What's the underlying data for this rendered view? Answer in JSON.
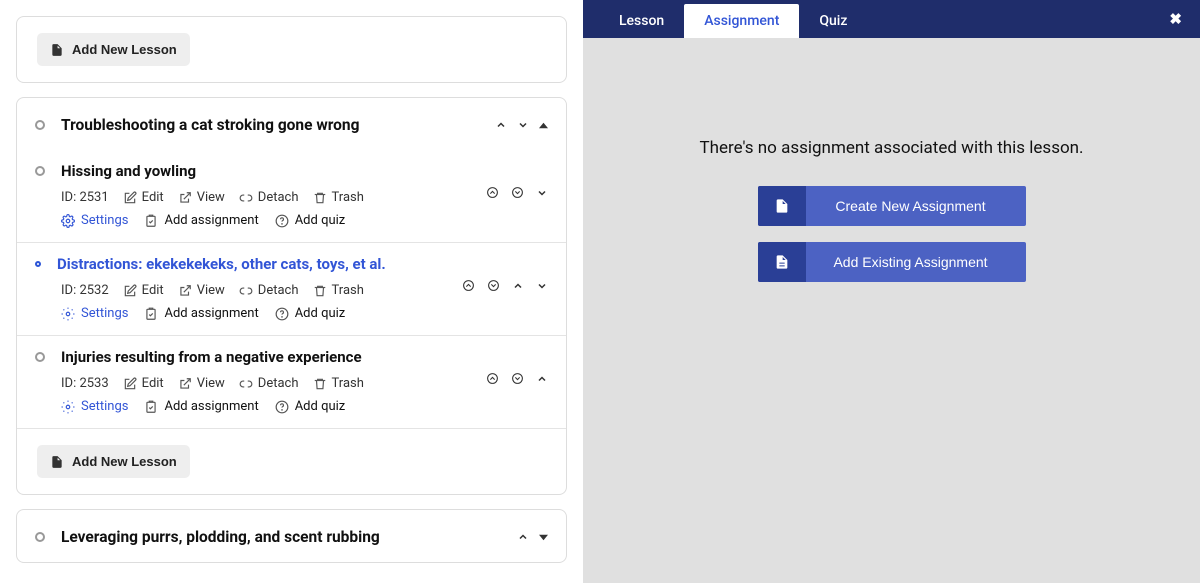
{
  "left": {
    "add_lesson_label": "Add New Lesson",
    "section1": {
      "title": "Troubleshooting a cat stroking gone wrong"
    },
    "lessons": [
      {
        "title": "Hissing and yowling",
        "active": false,
        "id_label": "ID: 2531",
        "edit": "Edit",
        "view": "View",
        "detach": "Detach",
        "trash": "Trash",
        "settings": "Settings",
        "add_assignment": "Add assignment",
        "add_quiz": "Add quiz",
        "chev_up": false,
        "chev_down": true
      },
      {
        "title": "Distractions: ekekekekeks, other cats, toys, et al.",
        "active": true,
        "id_label": "ID: 2532",
        "edit": "Edit",
        "view": "View",
        "detach": "Detach",
        "trash": "Trash",
        "settings": "Settings",
        "add_assignment": "Add assignment",
        "add_quiz": "Add quiz",
        "chev_up": true,
        "chev_down": true
      },
      {
        "title": "Injuries resulting from a negative experience",
        "active": false,
        "id_label": "ID: 2533",
        "edit": "Edit",
        "view": "View",
        "detach": "Detach",
        "trash": "Trash",
        "settings": "Settings",
        "add_assignment": "Add assignment",
        "add_quiz": "Add quiz",
        "chev_up": true,
        "chev_down": false
      }
    ],
    "section2": {
      "title": "Leveraging purrs, plodding, and scent rubbing"
    }
  },
  "right": {
    "tabs": {
      "lesson": "Lesson",
      "assignment": "Assignment",
      "quiz": "Quiz"
    },
    "empty_state": "There's no assignment associated with this lesson.",
    "create_btn": "Create New Assignment",
    "existing_btn": "Add Existing Assignment"
  }
}
